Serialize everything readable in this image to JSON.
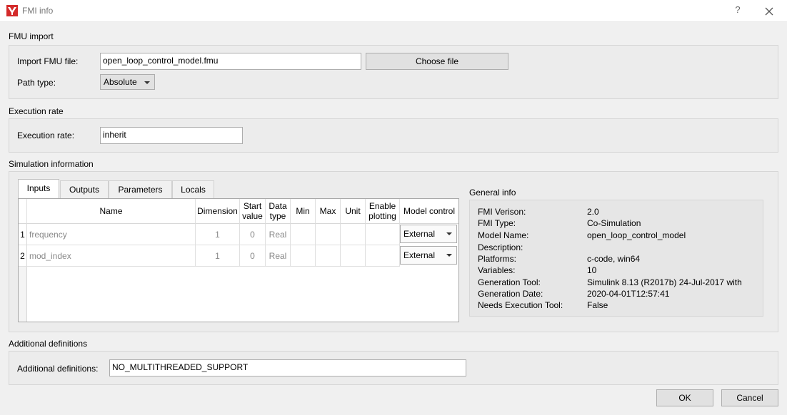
{
  "window": {
    "title": "FMI info",
    "help_label": "?"
  },
  "fmu_import": {
    "section_title": "FMU import",
    "file_label": "Import FMU file:",
    "file_value": "open_loop_control_model.fmu",
    "choose_button": "Choose file",
    "path_type_label": "Path type:",
    "path_type_value": "Absolute"
  },
  "execution_rate": {
    "section_title": "Execution rate",
    "label": "Execution rate:",
    "value": "inherit"
  },
  "simulation": {
    "section_title": "Simulation information",
    "tabs": [
      {
        "label": "Inputs",
        "active": true
      },
      {
        "label": "Outputs",
        "active": false
      },
      {
        "label": "Parameters",
        "active": false
      },
      {
        "label": "Locals",
        "active": false
      }
    ],
    "columns": {
      "name": "Name",
      "dimension": "Dimension",
      "start_value": "Start value",
      "data_type": "Data type",
      "min": "Min",
      "max": "Max",
      "unit": "Unit",
      "enable_plotting": "Enable plotting",
      "model_control": "Model control"
    },
    "rows": [
      {
        "num": "1",
        "name": "frequency",
        "dimension": "1",
        "start_value": "0",
        "data_type": "Real",
        "min": "",
        "max": "",
        "unit": "",
        "enable_plotting": "",
        "model_control": "External"
      },
      {
        "num": "2",
        "name": "mod_index",
        "dimension": "1",
        "start_value": "0",
        "data_type": "Real",
        "min": "",
        "max": "",
        "unit": "",
        "enable_plotting": "",
        "model_control": "External"
      }
    ]
  },
  "general_info": {
    "title": "General info",
    "items": [
      {
        "label": "FMI Verison:",
        "value": "2.0"
      },
      {
        "label": "FMI Type:",
        "value": "Co-Simulation"
      },
      {
        "label": "Model Name:",
        "value": "open_loop_control_model"
      },
      {
        "label": "Description:",
        "value": ""
      },
      {
        "label": "Platforms:",
        "value": "c-code, win64"
      },
      {
        "label": "Variables:",
        "value": "10"
      },
      {
        "label": "Generation Tool:",
        "value": "Simulink 8.13 (R2017b) 24-Jul-2017 with"
      },
      {
        "label": "Generation Date:",
        "value": "2020-04-01T12:57:41"
      },
      {
        "label": "Needs Execution Tool:",
        "value": "False"
      }
    ]
  },
  "additional": {
    "section_title": "Additional definitions",
    "label": "Additional definitions:",
    "value": "NO_MULTITHREADED_SUPPORT"
  },
  "buttons": {
    "ok": "OK",
    "cancel": "Cancel"
  },
  "colors": {
    "app_icon": "#d42a2a",
    "window_bg": "#f0f0f0"
  }
}
